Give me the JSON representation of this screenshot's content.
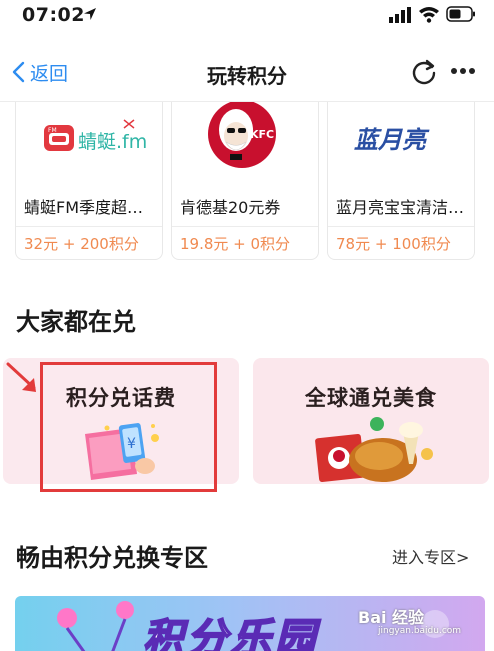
{
  "status_bar": {
    "time": "07:02"
  },
  "nav": {
    "back_label": "返回",
    "title": "玩转积分"
  },
  "products": [
    {
      "logo_text": "蜻蜓.fm",
      "name": "蜻蜓FM季度超…",
      "price": "32元 + 200积分"
    },
    {
      "logo_text": "KFC",
      "name": "肯德基20元券",
      "price": "19.8元 + 0积分"
    },
    {
      "logo_text": "蓝月亮",
      "name": "蓝月亮宝宝清洁…",
      "price": "78元 + 100积分"
    }
  ],
  "popular": {
    "title": "大家都在兑",
    "tiles": [
      {
        "label": "积分兑话费"
      },
      {
        "label": "全球通兑美食"
      }
    ]
  },
  "zone": {
    "title": "畅由积分兑换专区",
    "link": "进入专区>"
  },
  "banner": {
    "text": "积分乐园"
  },
  "watermark": {
    "text": "Bai 经验",
    "sub": "jingyan.baidu.com"
  },
  "colors": {
    "accent_blue": "#2d8cf0",
    "price_orange": "#f08a50",
    "highlight_red": "#e23b3b"
  }
}
